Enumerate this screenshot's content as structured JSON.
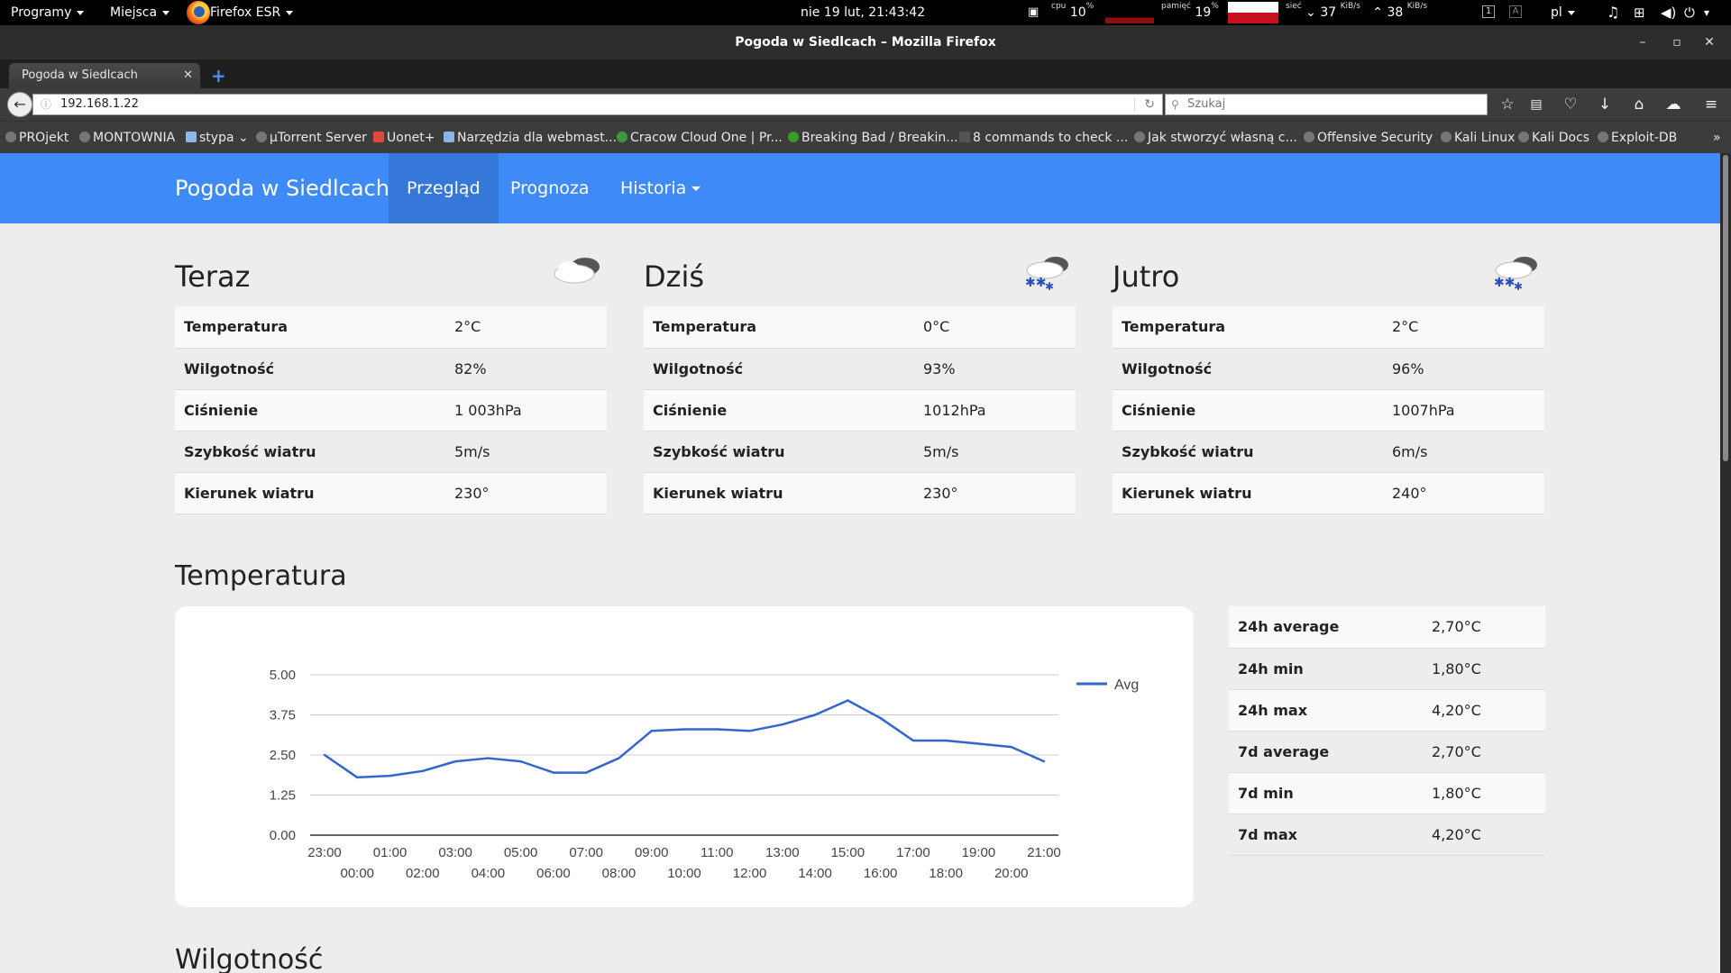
{
  "panel": {
    "programs": "Programy",
    "places": "Miejsca",
    "app": "Firefox ESR",
    "clock": "nie 19 lut, 21:43:42",
    "cpu_label": "cpu",
    "cpu_value": "10",
    "cpu_unit": "%",
    "mem_label": "pamięć",
    "mem_value": "19",
    "mem_unit": "%",
    "net_label": "sieć",
    "net_down": "37",
    "net_down_unit": "KiB/s",
    "net_up": "38",
    "net_up_unit": "KiB/s",
    "ws1": "1",
    "ws2": "A",
    "lang": "pl"
  },
  "window": {
    "title": "Pogoda w Siedlcach – Mozilla Firefox",
    "minimize": "–",
    "maximize": "▫",
    "close": "✕"
  },
  "tab": {
    "label": "Pogoda w Siedlcach",
    "close": "✕",
    "new": "+"
  },
  "toolbar": {
    "url": "192.168.1.22",
    "search_placeholder": "Szukaj"
  },
  "bookmarks": [
    "PROjekt",
    "MONTOWNIA",
    "stypa",
    "µTorrent Server",
    "Uonet+",
    "Narzędzia dla webmast...",
    "Cracow Cloud One | Pr...",
    "Breaking Bad / Breakin...",
    "8 commands to check ...",
    "Jak stworzyć własną c...",
    "Offensive Security",
    "Kali Linux",
    "Kali Docs",
    "Exploit-DB"
  ],
  "bookmark_more": "»",
  "nav": {
    "brand": "Pogoda w Siedlcach",
    "overview": "Przegląd",
    "forecast": "Prognoza",
    "history": "Historia"
  },
  "cards": [
    {
      "title": "Teraz",
      "icon": "cloudy-icon",
      "rows": [
        {
          "k": "Temperatura",
          "v": "2°C"
        },
        {
          "k": "Wilgotność",
          "v": "82%"
        },
        {
          "k": "Ciśnienie",
          "v": "1 003hPa"
        },
        {
          "k": "Szybkość wiatru",
          "v": "5m/s"
        },
        {
          "k": "Kierunek wiatru",
          "v": "230°"
        }
      ]
    },
    {
      "title": "Dziś",
      "icon": "snow-icon",
      "rows": [
        {
          "k": "Temperatura",
          "v": "0°C"
        },
        {
          "k": "Wilgotność",
          "v": "93%"
        },
        {
          "k": "Ciśnienie",
          "v": "1012hPa"
        },
        {
          "k": "Szybkość wiatru",
          "v": "5m/s"
        },
        {
          "k": "Kierunek wiatru",
          "v": "230°"
        }
      ]
    },
    {
      "title": "Jutro",
      "icon": "snow-icon",
      "rows": [
        {
          "k": "Temperatura",
          "v": "2°C"
        },
        {
          "k": "Wilgotność",
          "v": "96%"
        },
        {
          "k": "Ciśnienie",
          "v": "1007hPa"
        },
        {
          "k": "Szybkość wiatru",
          "v": "6m/s"
        },
        {
          "k": "Kierunek wiatru",
          "v": "240°"
        }
      ]
    }
  ],
  "temperature": {
    "heading": "Temperatura",
    "stats": [
      {
        "k": "24h average",
        "v": "2,70°C"
      },
      {
        "k": "24h min",
        "v": "1,80°C"
      },
      {
        "k": "24h max",
        "v": "4,20°C"
      },
      {
        "k": "7d average",
        "v": "2,70°C"
      },
      {
        "k": "7d min",
        "v": "1,80°C"
      },
      {
        "k": "7d max",
        "v": "4,20°C"
      }
    ]
  },
  "humidity": {
    "heading": "Wilgotność"
  },
  "colors": {
    "accent": "#3e8af7",
    "accent_active": "#3578d9",
    "series": "#3366cc"
  },
  "chart_data": {
    "type": "line",
    "x": [
      "23:00",
      "00:00",
      "01:00",
      "02:00",
      "03:00",
      "04:00",
      "05:00",
      "06:00",
      "07:00",
      "08:00",
      "09:00",
      "10:00",
      "11:00",
      "12:00",
      "13:00",
      "14:00",
      "15:00",
      "16:00",
      "17:00",
      "18:00",
      "19:00",
      "20:00",
      "21:00"
    ],
    "series": [
      {
        "name": "Avg",
        "values": [
          2.5,
          1.8,
          1.85,
          2.0,
          2.3,
          2.4,
          2.3,
          1.95,
          1.95,
          2.4,
          3.25,
          3.3,
          3.3,
          3.25,
          3.45,
          3.75,
          4.2,
          3.65,
          2.95,
          2.95,
          2.85,
          2.75,
          2.3
        ]
      }
    ],
    "yticks": [
      "5.00",
      "3.75",
      "2.50",
      "1.25",
      "0.00"
    ],
    "ylim": [
      0,
      5
    ],
    "grid": true,
    "legend": "right"
  }
}
